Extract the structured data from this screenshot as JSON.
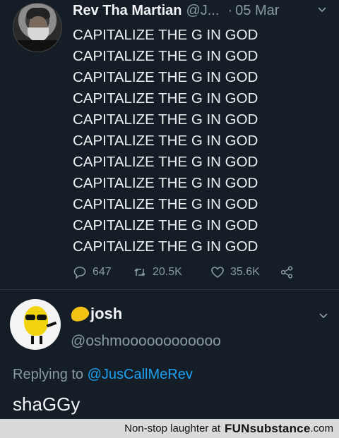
{
  "tweet": {
    "display_name": "Rev Tha Martian",
    "handle": "@J...",
    "separator": "·",
    "date": "05 Mar",
    "lines": [
      "CAPITALIZE THE G IN GOD",
      "CAPITALIZE THE G IN GOD",
      "CAPITALIZE THE G IN GOD",
      "CAPITALIZE THE G IN GOD",
      "CAPITALIZE THE G IN GOD",
      "CAPITALIZE THE G IN GOD",
      "CAPITALIZE THE G IN GOD",
      "CAPITALIZE THE G IN GOD",
      "CAPITALIZE THE G IN GOD",
      "CAPITALIZE THE G IN GOD",
      "CAPITALIZE THE G IN GOD"
    ],
    "reply_count": "647",
    "retweet_count": "20.5K",
    "like_count": "35.6K",
    "icons": [
      "chevron-down-icon",
      "reply-icon",
      "retweet-icon",
      "like-icon",
      "share-icon"
    ]
  },
  "reply": {
    "display_name": "josh",
    "handle": "@oshmoooooooooooo",
    "replying_prefix": "Replying to",
    "replying_to": "@JusCallMeRev",
    "text": "shaGGy",
    "icons": [
      "lemon-emoji-icon",
      "chevron-down-icon"
    ]
  },
  "watermark": {
    "text": "Non-stop laughter at",
    "brand": "FUNsubstance",
    "domain": ".com"
  },
  "colors": {
    "background": "#151d26",
    "muted": "#8899a6",
    "link": "#1da1f2",
    "watermark_bg": "#d9dadb"
  }
}
